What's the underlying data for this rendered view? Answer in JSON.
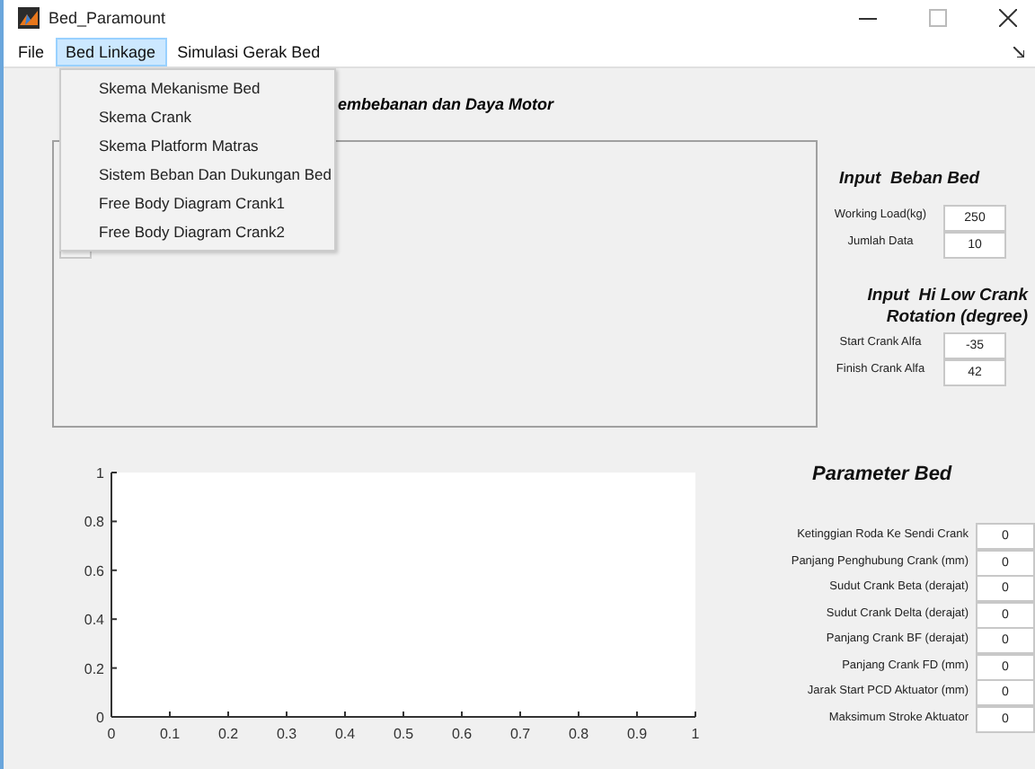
{
  "window": {
    "title": "Bed_Paramount"
  },
  "menu_bar": [
    {
      "label": "File",
      "selected": false
    },
    {
      "label": "Bed Linkage",
      "selected": true
    },
    {
      "label": "Simulasi Gerak Bed",
      "selected": false
    }
  ],
  "dropdown_menu": [
    "Skema Mekanisme Bed",
    "Skema Crank",
    "Skema Platform Matras",
    "Sistem Beban Dan Dukungan Bed",
    "Free Body Diagram Crank1",
    "Free Body Diagram Crank2"
  ],
  "panel_title": "embebanan dan Daya Motor",
  "input_beban": {
    "title": "Input  Beban Bed",
    "fields": [
      {
        "label": "Working Load(kg)",
        "value": "250"
      },
      {
        "label": "Jumlah Data",
        "value": "10"
      }
    ]
  },
  "input_crank": {
    "title": "Input  Hi Low Crank Rotation (degree)",
    "fields": [
      {
        "label": "Start Crank Alfa",
        "value": "-35"
      },
      {
        "label": "Finish Crank Alfa",
        "value": "42"
      }
    ]
  },
  "chart_data": {
    "type": "line",
    "xlim": [
      0,
      1
    ],
    "ylim": [
      0,
      1
    ],
    "xticks": [
      0,
      0.1,
      0.2,
      0.3,
      0.4,
      0.5,
      0.6,
      0.7,
      0.8,
      0.9,
      1
    ],
    "yticks": [
      0,
      0.2,
      0.4,
      0.6,
      0.8,
      1
    ]
  },
  "parameter_bed": {
    "title": "Parameter Bed",
    "fields": [
      {
        "label": "Ketinggian Roda Ke Sendi Crank",
        "value": "0"
      },
      {
        "label": "Panjang Penghubung Crank (mm)",
        "value": "0"
      },
      {
        "label": "Sudut Crank Beta (derajat)",
        "value": "0"
      },
      {
        "label": "Sudut Crank Delta (derajat)",
        "value": "0"
      },
      {
        "label": "Panjang Crank BF (derajat)",
        "value": "0"
      },
      {
        "label": "Panjang Crank FD (mm)",
        "value": "0"
      },
      {
        "label": "Jarak Start PCD Aktuator (mm)",
        "value": "0"
      },
      {
        "label": "Maksimum Stroke Aktuator",
        "value": "0"
      }
    ]
  }
}
